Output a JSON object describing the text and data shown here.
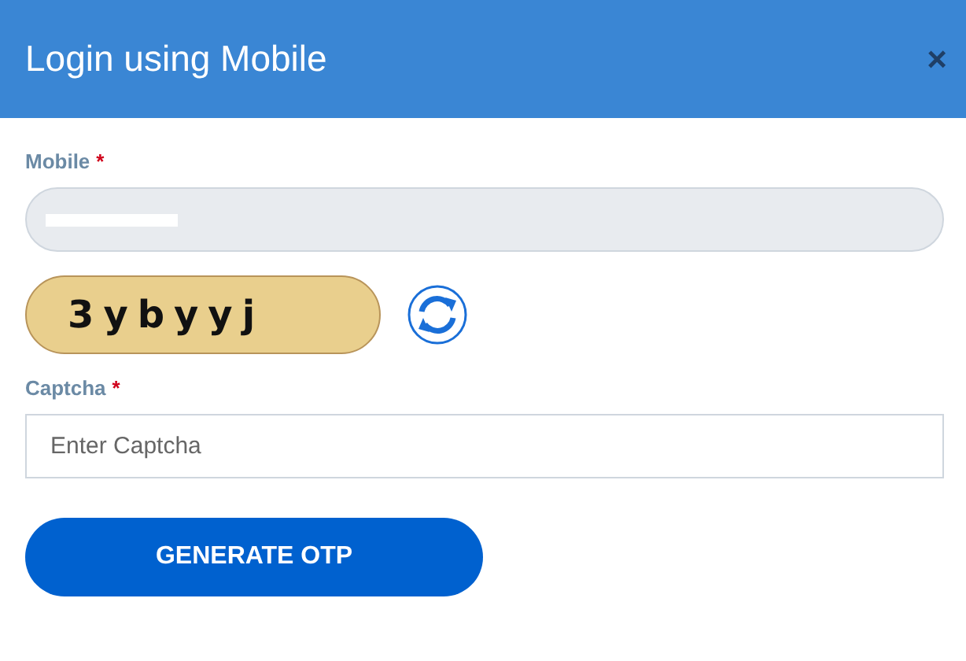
{
  "dialog": {
    "title": "Login using Mobile",
    "close": "×"
  },
  "mobile": {
    "label": "Mobile",
    "required_mark": "*",
    "redacted": true
  },
  "captcha_image": {
    "text": "3ybyyj"
  },
  "captcha": {
    "label": "Captcha",
    "required_mark": "*",
    "placeholder": "Enter Captcha"
  },
  "button": "GENERATE OTP"
}
